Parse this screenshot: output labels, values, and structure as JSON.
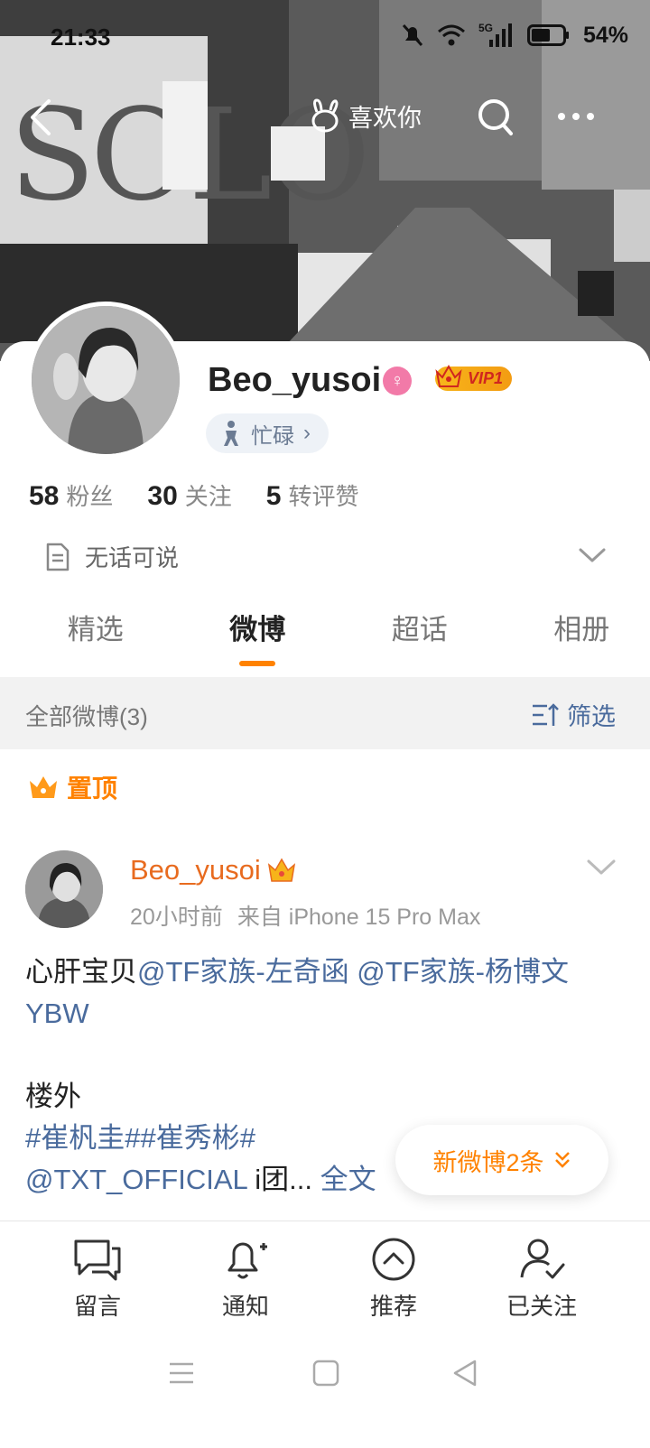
{
  "status_bar": {
    "time": "21:33",
    "network": "5G",
    "battery": "54%"
  },
  "nav": {
    "like_label": "喜欢你"
  },
  "profile": {
    "username": "Beo_yusoi",
    "vip_label": "VIP1",
    "status_chip": "忙碌",
    "stats": [
      {
        "value": "58",
        "label": "粉丝"
      },
      {
        "value": "30",
        "label": "关注"
      },
      {
        "value": "5",
        "label": "转评赞"
      }
    ],
    "bio": "无话可说"
  },
  "tabs": [
    {
      "label": "精选",
      "active": false
    },
    {
      "label": "微博",
      "active": true
    },
    {
      "label": "超话",
      "active": false
    },
    {
      "label": "相册",
      "active": false
    }
  ],
  "filter": {
    "count_label": "全部微博(3)",
    "filter_label": "筛选"
  },
  "pinned_label": "置顶",
  "post": {
    "author": "Beo_yusoi",
    "time": "20小时前",
    "source": "来自 iPhone 15 Pro Max",
    "line1_text": "心肝宝贝",
    "mention1": "@TF家族-左奇函",
    "mention2": "@TF家族-杨博文YBW",
    "line2_text": "楼外",
    "tags": "#崔杋圭##崔秀彬#",
    "mention3": "@TXT_OFFICIAL",
    "tail_text": " i团...",
    "full_link": "全文"
  },
  "new_posts_label": "新微博2条",
  "bottom_bar": [
    {
      "label": "留言",
      "icon": "message-icon"
    },
    {
      "label": "通知",
      "icon": "bell-icon"
    },
    {
      "label": "推荐",
      "icon": "recommend-icon"
    },
    {
      "label": "已关注",
      "icon": "followed-icon"
    }
  ],
  "colors": {
    "accent": "#ff8200",
    "link": "#4a6b9d",
    "author": "#e86b1f"
  }
}
